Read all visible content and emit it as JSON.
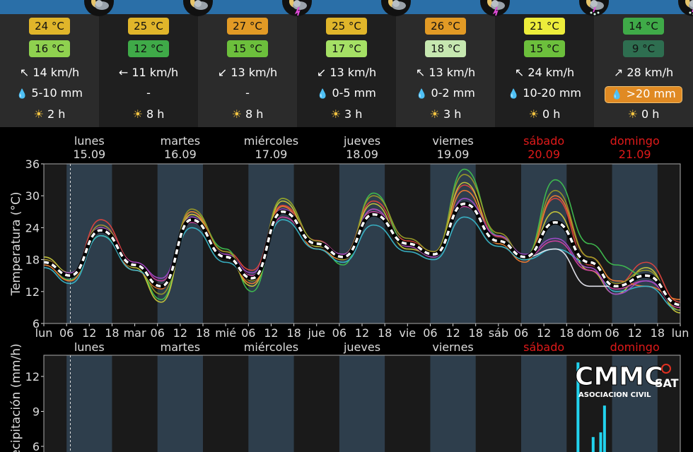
{
  "forecast": {
    "days": [
      {
        "max_temp": "24 °C",
        "max_color": "#e0b52a",
        "min_temp": "16 °C",
        "min_color": "#8fd14f",
        "wind": "14 km/h",
        "wind_arrow": "↖",
        "rain": "5-10 mm",
        "rain_warning": false,
        "sun": "2 h"
      },
      {
        "max_temp": "25 °C",
        "max_color": "#e0b52a",
        "min_temp": "12 °C",
        "min_color": "#3faa48",
        "wind": "11 km/h",
        "wind_arrow": "←",
        "rain": "-",
        "rain_warning": false,
        "sun": "8 h"
      },
      {
        "max_temp": "27 °C",
        "max_color": "#e29a25",
        "min_temp": "15 °C",
        "min_color": "#6cbf3c",
        "wind": "13 km/h",
        "wind_arrow": "↙",
        "rain": "-",
        "rain_warning": false,
        "sun": "8 h"
      },
      {
        "max_temp": "25 °C",
        "max_color": "#e0b52a",
        "min_temp": "17 °C",
        "min_color": "#a5e065",
        "wind": "13 km/h",
        "wind_arrow": "↙",
        "rain": "0-5 mm",
        "rain_warning": false,
        "sun": "3 h"
      },
      {
        "max_temp": "26 °C",
        "max_color": "#e29a25",
        "min_temp": "18 °C",
        "min_color": "#c6e7b0",
        "wind": "13 km/h",
        "wind_arrow": "↖",
        "rain": "0-2 mm",
        "rain_warning": false,
        "sun": "3 h"
      },
      {
        "max_temp": "21 °C",
        "max_color": "#eded3b",
        "min_temp": "15 °C",
        "min_color": "#6cbf3c",
        "wind": "24 km/h",
        "wind_arrow": "↖",
        "rain": "10-20 mm",
        "rain_warning": false,
        "sun": "0 h"
      },
      {
        "max_temp": "14 °C",
        "max_color": "#3faa48",
        "min_temp": "9 °C",
        "min_color": "#2e6e50",
        "wind": "28 km/h",
        "wind_arrow": "↗",
        "rain": ">20 mm",
        "rain_warning": true,
        "sun": "0 h"
      }
    ]
  },
  "logo": {
    "name": "CMMC",
    "suffix": "SAT",
    "subtitle": "ASOCIACION CIVIL"
  },
  "chart_data": [
    {
      "type": "line",
      "ylabel": "Temperatura (°C)",
      "ylim": [
        6,
        36
      ],
      "yticks": [
        6,
        12,
        18,
        24,
        30,
        36
      ],
      "x_unit": "hours since lun 00:00",
      "xlim": [
        0,
        168
      ],
      "x_tick_labels": [
        "lun",
        "06",
        "12",
        "18",
        "mar",
        "06",
        "12",
        "18",
        "mié",
        "06",
        "12",
        "18",
        "jue",
        "06",
        "12",
        "18",
        "vie",
        "06",
        "12",
        "18",
        "sáb",
        "06",
        "12",
        "18",
        "dom",
        "06",
        "12",
        "18",
        "lun"
      ],
      "day_labels": [
        {
          "name": "lunes",
          "date": "15.09",
          "weekend": false
        },
        {
          "name": "martes",
          "date": "16.09",
          "weekend": false
        },
        {
          "name": "miércoles",
          "date": "17.09",
          "weekend": false
        },
        {
          "name": "jueves",
          "date": "18.09",
          "weekend": false
        },
        {
          "name": "viernes",
          "date": "19.09",
          "weekend": false
        },
        {
          "name": "sábado",
          "date": "20.09",
          "weekend": true
        },
        {
          "name": "domingo",
          "date": "21.09",
          "weekend": true
        }
      ],
      "now_marker_x": 7,
      "grid": false,
      "mean_series": {
        "x": [
          0,
          7,
          15,
          24,
          31,
          39,
          48,
          55,
          63,
          72,
          79,
          87,
          96,
          103,
          111,
          120,
          127,
          135,
          144,
          151,
          159,
          168
        ],
        "y": [
          17.5,
          15,
          23.5,
          17,
          13,
          25.5,
          18.5,
          14.5,
          27,
          21,
          18.5,
          26.5,
          21,
          19,
          28.5,
          21.5,
          18.5,
          25,
          17.5,
          13,
          15,
          9.5
        ]
      },
      "series": [
        {
          "color": "#e0443e",
          "offsets": [
            0.5,
            0.3,
            2.0,
            0.5,
            0.3,
            1.0,
            1.0,
            1.5,
            1.2,
            0.6,
            0.5,
            2.5,
            0.5,
            0.5,
            3.5,
            0.8,
            0.2,
            4.5,
            -0.5,
            0.3,
            2.5,
            0.5
          ]
        },
        {
          "color": "#3fbf4f",
          "offsets": [
            -0.5,
            -0.8,
            -1.0,
            0.0,
            -2.5,
            1.5,
            1.5,
            -2.5,
            2.5,
            0.5,
            -1.5,
            4.0,
            0.0,
            0.0,
            6.5,
            1.0,
            0.0,
            8.0,
            3.5,
            4.0,
            0.0,
            0.0
          ]
        },
        {
          "color": "#c8c83a",
          "offsets": [
            1.0,
            0.5,
            0.5,
            -0.5,
            -3.0,
            1.0,
            0.0,
            -1.5,
            2.0,
            -0.5,
            0.5,
            2.0,
            -1.0,
            0.0,
            4.0,
            -0.5,
            -0.5,
            2.0,
            -1.5,
            -1.5,
            1.5,
            -1.5
          ]
        },
        {
          "color": "#d040a0",
          "offsets": [
            0.0,
            0.0,
            1.0,
            0.5,
            1.0,
            -0.5,
            0.5,
            0.5,
            -1.0,
            0.0,
            0.5,
            0.5,
            0.0,
            0.0,
            -0.5,
            0.0,
            0.0,
            -3.5,
            -1.5,
            -0.5,
            -1.0,
            -0.5
          ]
        },
        {
          "color": "#f07a30",
          "offsets": [
            -0.5,
            -1.0,
            0.5,
            -1.0,
            -0.5,
            1.5,
            0.0,
            -1.0,
            1.0,
            -1.0,
            -0.5,
            1.0,
            -0.5,
            -0.5,
            2.5,
            -0.5,
            -1.0,
            5.0,
            1.0,
            1.0,
            -2.0,
            1.0
          ]
        },
        {
          "color": "#39b5c8",
          "offsets": [
            -1.0,
            -1.5,
            -1.0,
            -1.0,
            0.0,
            -1.5,
            -1.0,
            0.0,
            -1.5,
            -1.0,
            -1.0,
            -2.0,
            -1.5,
            -1.0,
            -2.5,
            -1.0,
            -0.5,
            -5.0,
            0.0,
            -1.0,
            -2.0,
            -1.0
          ]
        },
        {
          "color": "#a04ac8",
          "offsets": [
            0.0,
            0.5,
            0.5,
            0.5,
            1.5,
            0.5,
            0.5,
            1.0,
            0.5,
            0.5,
            0.5,
            1.0,
            -0.5,
            -0.5,
            1.0,
            1.0,
            0.5,
            -3.0,
            -1.0,
            -1.5,
            -1.0,
            0.0
          ]
        },
        {
          "color": "#9a9a28",
          "offsets": [
            0.5,
            0.0,
            1.0,
            0.0,
            -1.5,
            2.0,
            1.0,
            -0.5,
            2.5,
            0.5,
            -0.5,
            3.5,
            1.0,
            0.5,
            5.5,
            1.5,
            0.0,
            6.0,
            1.0,
            0.5,
            1.0,
            -1.0
          ]
        },
        {
          "color": "#e8e8f0",
          "offsets": [
            0.0,
            0.0,
            0.0,
            0.0,
            0.0,
            0.0,
            0.0,
            0.0,
            0.0,
            0.0,
            0.0,
            0.0,
            0.0,
            0.0,
            0.0,
            0.0,
            0.0,
            -5.0,
            -4.5,
            0.0,
            0.0,
            0.0
          ]
        }
      ]
    },
    {
      "type": "bar",
      "ylabel": "Precipitación (mm/h)",
      "yticks": [
        6,
        9,
        12
      ],
      "x_unit": "hours since lun 00:00",
      "day_labels": [
        {
          "name": "lunes",
          "weekend": false
        },
        {
          "name": "martes",
          "weekend": false
        },
        {
          "name": "miércoles",
          "weekend": false
        },
        {
          "name": "jueves",
          "weekend": false
        },
        {
          "name": "viernes",
          "weekend": false
        },
        {
          "name": "sábado",
          "weekend": true
        },
        {
          "name": "domingo",
          "weekend": true
        }
      ],
      "bars": [
        {
          "x": 141,
          "value": 13.2
        },
        {
          "x": 145,
          "value": 6.8
        },
        {
          "x": 147,
          "value": 7.2
        },
        {
          "x": 148,
          "value": 9.5
        }
      ],
      "bar_color": "#22d3ee"
    }
  ]
}
